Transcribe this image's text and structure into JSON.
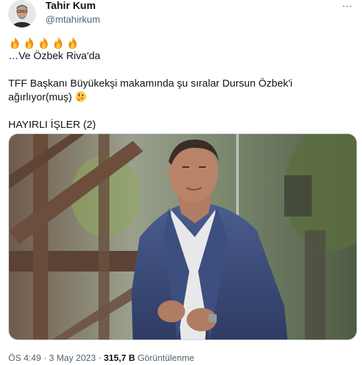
{
  "author": {
    "display_name": "Tahir Kum",
    "handle": "@mtahirkum"
  },
  "more_icon": "…",
  "tweet": {
    "emoji_fire_count": 5,
    "line1": "…Ve Özbek Riva'da",
    "line2": "TFF Başkanı Büyükekşi makamında şu sıralar Dursun Özbek'i",
    "line3": "ağırlıyor(muş)",
    "line4": "HAYIRLI İŞLER (2)"
  },
  "meta": {
    "time": "ÖS 4:49",
    "sep1": " · ",
    "date": "3 May 2023",
    "sep2": " · ",
    "views": "315,7 B",
    "views_label": " Görüntülenme"
  },
  "colors": {
    "text": "#0f1419",
    "secondary": "#536471",
    "border": "#cfd9de"
  }
}
